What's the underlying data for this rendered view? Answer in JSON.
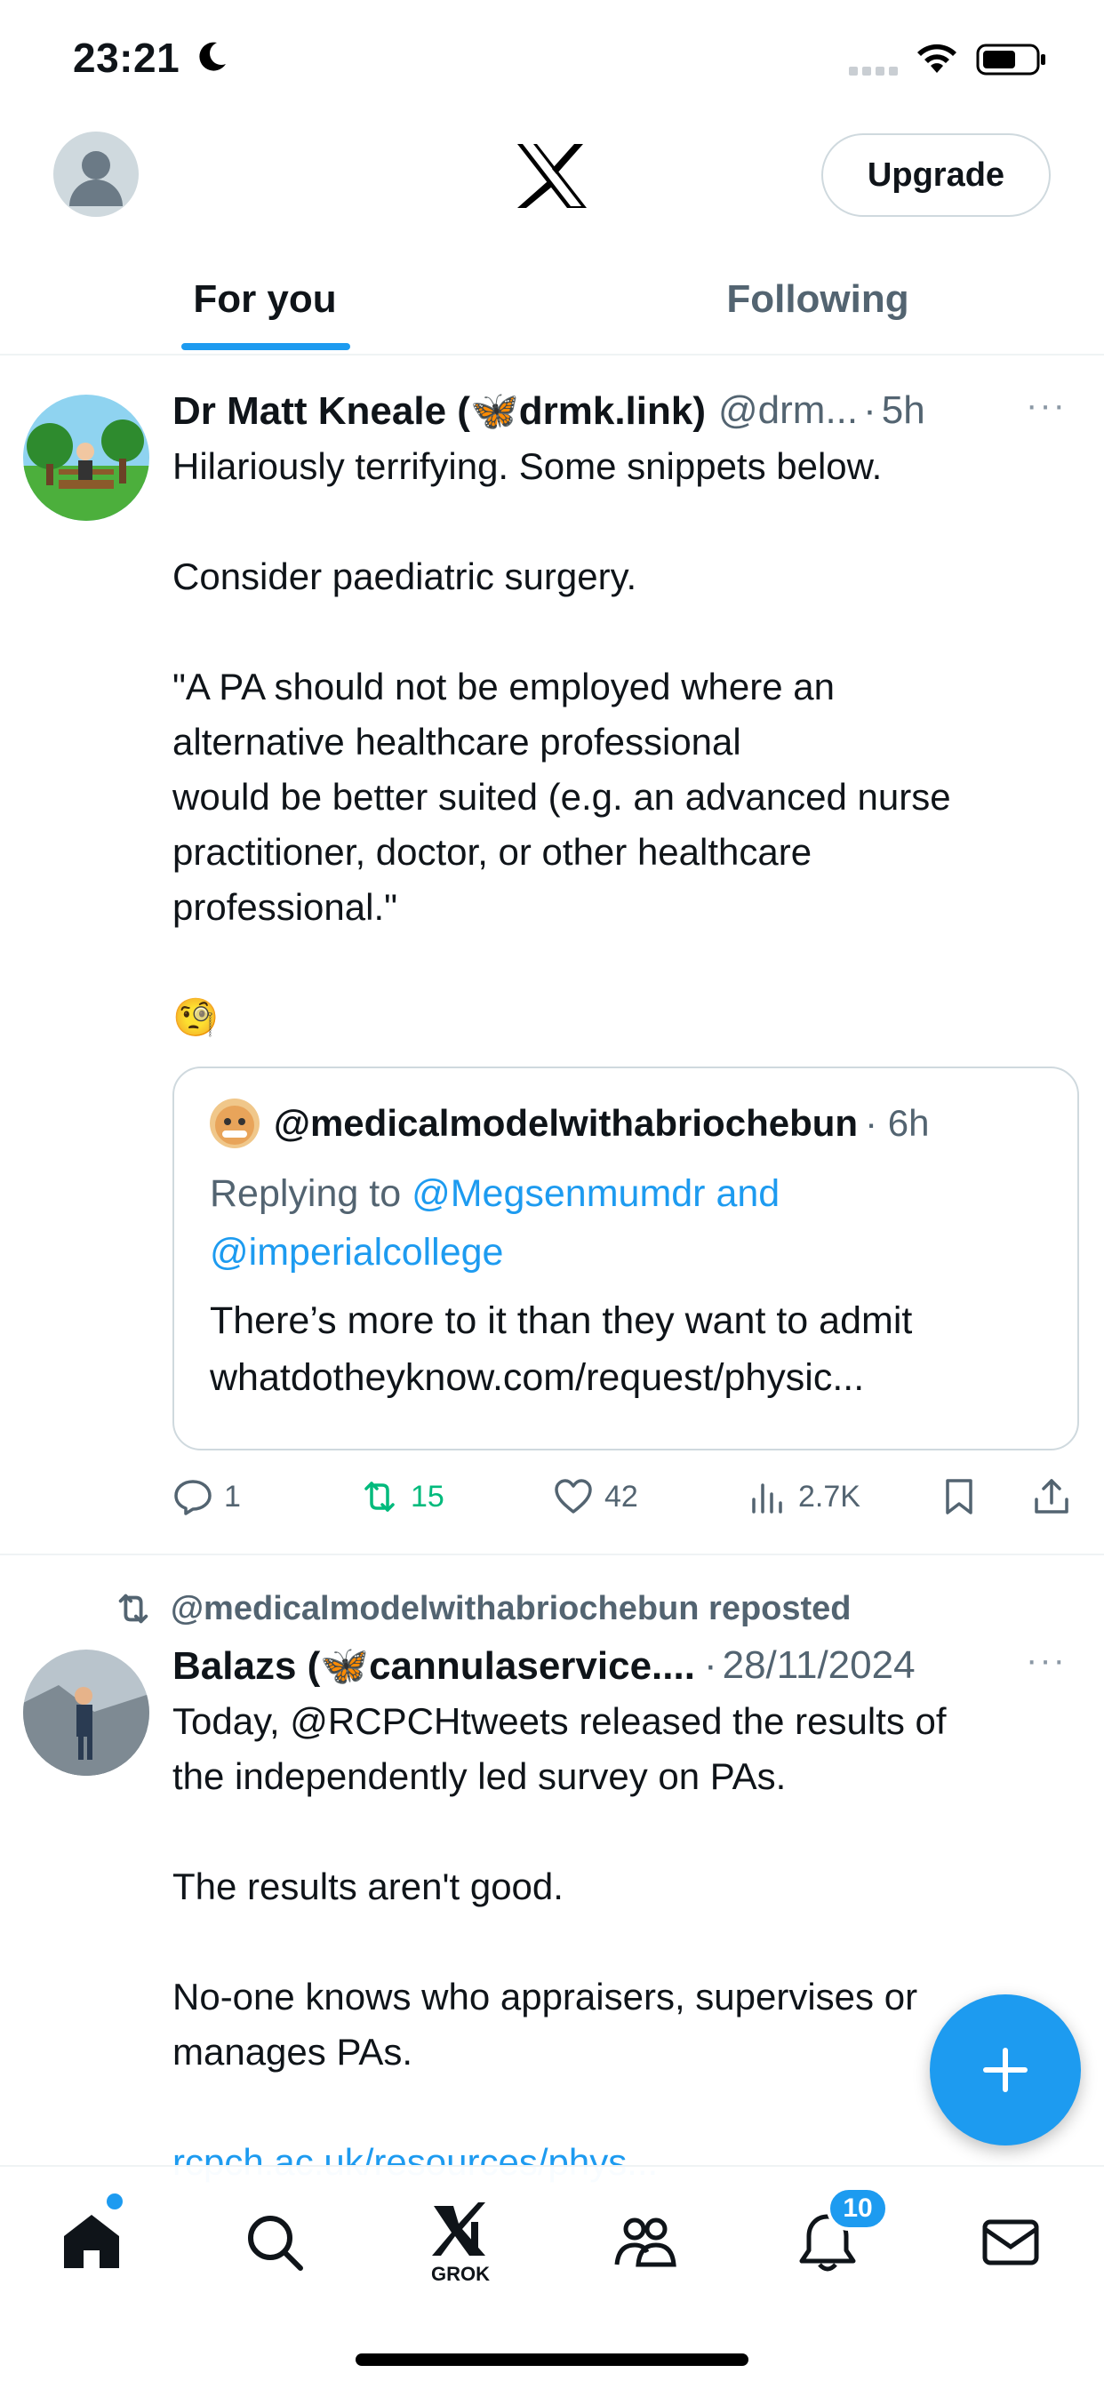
{
  "status_bar": {
    "time": "23:21"
  },
  "header": {
    "upgrade_label": "Upgrade",
    "tabs": [
      {
        "label": "For you",
        "active": true
      },
      {
        "label": "Following",
        "active": false
      }
    ]
  },
  "tweets": [
    {
      "display_name": "Dr Matt Kneale (🦋drmk.link)",
      "handle": "@drm...",
      "dot": "·",
      "time": "5h",
      "more": "···",
      "text_line1": "Hilariously terrifying. Some snippets below.",
      "text_line2": "Consider paediatric surgery.",
      "text_quote": "\"A PA should not be employed where an\nalternative healthcare professional\nwould be better suited (e.g. an advanced nurse\npractitioner, doctor, or other healthcare\nprofessional.\"",
      "emoji": "🧐",
      "quoted": {
        "handle": "@medicalmodelwithabriochebun",
        "time": "· 6h",
        "replying_prefix": "Replying to ",
        "replying_to_1": "@Megsenmumdr and",
        "replying_to_2": "@imperialcollege",
        "text_line1": "There’s more to it than they want to admit",
        "text_line2": "whatdotheyknow.com/request/physic..."
      },
      "actions": {
        "replies": "1",
        "reposts": "15",
        "likes": "42",
        "views": "2.7K"
      }
    },
    {
      "repost_label": "@medicalmodelwithabriochebun reposted",
      "display_name": "Balazs (🦋cannulaservice....",
      "dot": "·",
      "time": "28/11/2024",
      "more": "···",
      "text_line1": "Today, @RCPCHtweets released the results of\nthe independently led survey on PAs.",
      "text_line2": "The results aren't good.",
      "text_line3": "No-one knows who appraisers, supervises or\nmanages PAs.",
      "link": "rcpch.ac.uk/resources/phys..."
    }
  ],
  "bottom_nav": {
    "grok_label": "GROK",
    "notifications_badge": "10"
  },
  "colors": {
    "accent": "#1d9bf0",
    "repost_green": "#00ba7c",
    "secondary_text": "#536471"
  }
}
